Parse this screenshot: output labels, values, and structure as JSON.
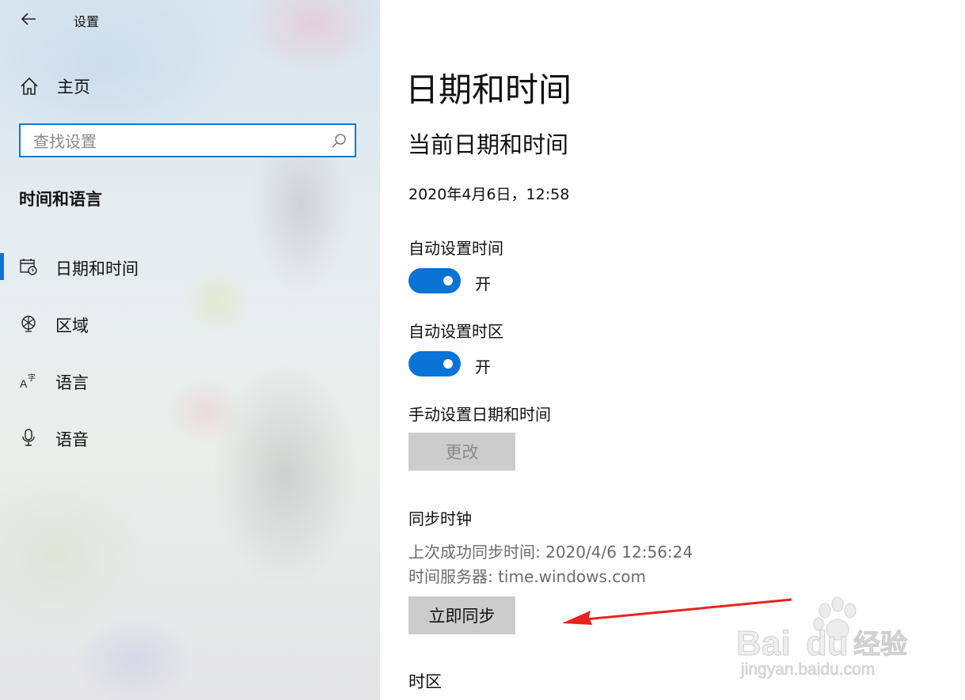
{
  "window": {
    "title": "设置"
  },
  "sidebar": {
    "home_label": "主页",
    "search_placeholder": "查找设置",
    "section_title": "时间和语言",
    "items": [
      {
        "label": "日期和时间",
        "icon": "calendar-clock-icon",
        "selected": true
      },
      {
        "label": "区域",
        "icon": "globe-icon",
        "selected": false
      },
      {
        "label": "语言",
        "icon": "language-icon",
        "selected": false
      },
      {
        "label": "语音",
        "icon": "microphone-icon",
        "selected": false
      }
    ]
  },
  "main": {
    "title": "日期和时间",
    "subtitle": "当前日期和时间",
    "current_datetime": "2020年4月6日，12:58",
    "auto_time": {
      "label": "自动设置时间",
      "state": "开",
      "on": true
    },
    "auto_timezone": {
      "label": "自动设置时区",
      "state": "开",
      "on": true
    },
    "manual": {
      "label": "手动设置日期和时间",
      "button": "更改"
    },
    "sync": {
      "heading": "同步时钟",
      "last_sync": "上次成功同步时间: 2020/4/6 12:56:24",
      "server": "时间服务器: time.windows.com",
      "button": "立即同步"
    },
    "timezone_heading": "时区"
  },
  "watermark": {
    "brand_left": "Bai",
    "brand_right": "du",
    "brand_cn": "经验",
    "url": "jingyan.baidu.com"
  },
  "colors": {
    "accent": "#0a73d6",
    "button_bg": "#cccccc",
    "arrow": "#e8231e"
  }
}
